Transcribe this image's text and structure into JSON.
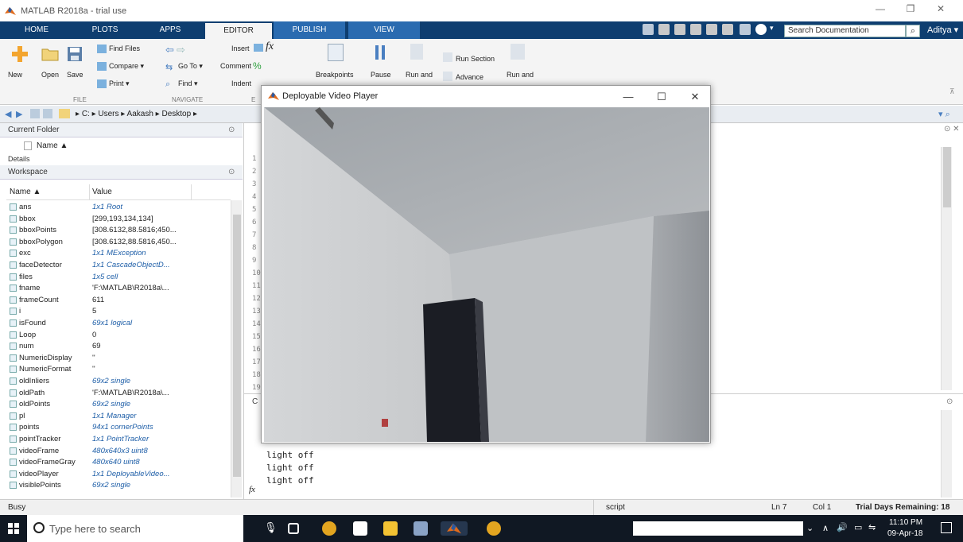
{
  "app": {
    "title": "MATLAB R2018a - trial use",
    "controls": {
      "minimize": "—",
      "restore": "❐",
      "close": "✕"
    }
  },
  "ribbon": {
    "tabs": [
      {
        "label": "HOME"
      },
      {
        "label": "PLOTS"
      },
      {
        "label": "APPS"
      },
      {
        "label": "EDITOR"
      },
      {
        "label": "PUBLISH"
      },
      {
        "label": "VIEW"
      }
    ],
    "active_tab": "EDITOR",
    "search_placeholder": "Search Documentation",
    "user": "Aditya ▾",
    "file_group": {
      "label": "FILE",
      "new": "New",
      "open": "Open",
      "save": "Save",
      "find_files": "Find Files",
      "compare": "Compare ▾",
      "print": "Print ▾"
    },
    "navigate_group": {
      "label": "NAVIGATE",
      "go_to": "Go To ▾",
      "find": "Find ▾"
    },
    "edit_group": {
      "label": "E",
      "insert": "Insert",
      "comment": "Comment",
      "indent": "Indent"
    },
    "breakpoints": "Breakpoints",
    "pause": "Pause",
    "run_and": "Run and",
    "run_section": "Run Section",
    "advance": "Advance",
    "run_and2": "Run and"
  },
  "address": {
    "path": [
      "C:",
      "Users",
      "Aakash",
      "Desktop"
    ]
  },
  "current_folder": {
    "title": "Current Folder",
    "name_header": "Name ▲",
    "details_label": "Details"
  },
  "workspace": {
    "title": "Workspace",
    "headers": {
      "name": "Name ▲",
      "value": "Value"
    },
    "rows": [
      {
        "name": "ans",
        "value": "1x1 Root",
        "italic": true
      },
      {
        "name": "bbox",
        "value": "[299,193,134,134]",
        "italic": false
      },
      {
        "name": "bboxPoints",
        "value": "[308.6132,88.5816;450...",
        "italic": false
      },
      {
        "name": "bboxPolygon",
        "value": "[308.6132,88.5816,450...",
        "italic": false
      },
      {
        "name": "exc",
        "value": "1x1 MException",
        "italic": true
      },
      {
        "name": "faceDetector",
        "value": "1x1 CascadeObjectD...",
        "italic": true
      },
      {
        "name": "files",
        "value": "1x5 cell",
        "italic": true
      },
      {
        "name": "fname",
        "value": "'F:\\MATLAB\\R2018a\\...",
        "italic": false
      },
      {
        "name": "frameCount",
        "value": "611",
        "italic": false
      },
      {
        "name": "i",
        "value": "5",
        "italic": false
      },
      {
        "name": "isFound",
        "value": "69x1 logical",
        "italic": true
      },
      {
        "name": "Loop",
        "value": "0",
        "italic": false
      },
      {
        "name": "num",
        "value": "69",
        "italic": false
      },
      {
        "name": "NumericDisplay",
        "value": "''",
        "italic": false
      },
      {
        "name": "NumericFormat",
        "value": "''",
        "italic": false
      },
      {
        "name": "oldInliers",
        "value": "69x2 single",
        "italic": true
      },
      {
        "name": "oldPath",
        "value": "'F:\\MATLAB\\R2018a\\...",
        "italic": false
      },
      {
        "name": "oldPoints",
        "value": "69x2 single",
        "italic": true
      },
      {
        "name": "pl",
        "value": "1x1 Manager",
        "italic": true
      },
      {
        "name": "points",
        "value": "94x1 cornerPoints",
        "italic": true
      },
      {
        "name": "pointTracker",
        "value": "1x1 PointTracker",
        "italic": true
      },
      {
        "name": "videoFrame",
        "value": "480x640x3 uint8",
        "italic": true
      },
      {
        "name": "videoFrameGray",
        "value": "480x640 uint8",
        "italic": true
      },
      {
        "name": "videoPlayer",
        "value": "1x1 DeployableVideo...",
        "italic": true
      },
      {
        "name": "visiblePoints",
        "value": "69x2 single",
        "italic": true
      }
    ]
  },
  "editor": {
    "line_numbers": [
      "1",
      "2",
      "3",
      "4",
      "5",
      "6",
      "7",
      "8",
      "9",
      "10",
      "11",
      "12",
      "13",
      "14",
      "15",
      "16",
      "17",
      "18",
      "19"
    ]
  },
  "command_window": {
    "title": "C",
    "lines": [
      "light off",
      "light off",
      "light off"
    ],
    "prompt": "fx"
  },
  "video_player": {
    "title": "Deployable Video Player",
    "controls": {
      "minimize": "—",
      "maximize": "☐",
      "close": "✕"
    }
  },
  "statusbar": {
    "status": "Busy",
    "mode": "script",
    "ln": "Ln  7",
    "col": "Col  1",
    "trial": "Trial Days Remaining: 18"
  },
  "taskbar": {
    "search_placeholder": "Type here to search",
    "time": "11:10 PM",
    "date": "09-Apr-18"
  },
  "colors": {
    "tab_bar": "#0e3e70",
    "italic_value": "#1f5fa8",
    "taskbar": "#101823"
  }
}
